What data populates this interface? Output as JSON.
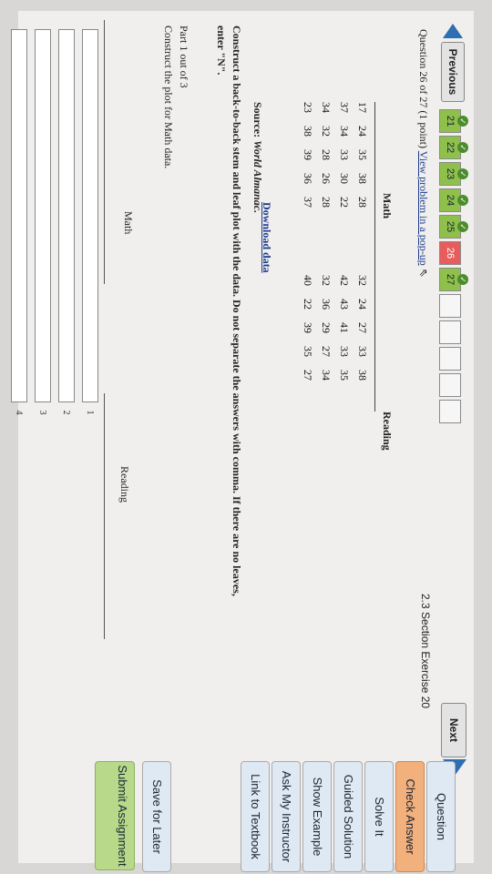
{
  "nav": {
    "previous_label": "Previous",
    "next_label": "Next",
    "question_numbers": [
      "21",
      "22",
      "23",
      "24",
      "25",
      "26",
      "27"
    ],
    "completed": [
      "21",
      "22",
      "23",
      "24",
      "25",
      "27"
    ],
    "current": "26"
  },
  "question": {
    "header": "Question 26 of 27 (1 point)",
    "popup_link": "View problem in a pop-up",
    "section": "2.3 Section Exercise 20"
  },
  "tables": {
    "math_title": "Math",
    "reading_title": "Reading",
    "math_rows": [
      [
        "17",
        "24",
        "35",
        "38",
        "28"
      ],
      [
        "37",
        "34",
        "33",
        "30",
        "22"
      ],
      [
        "34",
        "32",
        "28",
        "26",
        "28"
      ],
      [
        "23",
        "38",
        "39",
        "36",
        "37"
      ]
    ],
    "reading_rows": [
      [
        "32",
        "24",
        "27",
        "33",
        "38"
      ],
      [
        "42",
        "43",
        "41",
        "33",
        "35"
      ],
      [
        "32",
        "36",
        "29",
        "27",
        "34"
      ],
      [
        "40",
        "22",
        "39",
        "35",
        "27"
      ]
    ]
  },
  "source_label": "Source:",
  "source_name": "World Almanac.",
  "download_label": "Download data",
  "instructions": "Construct a back-to-back stem and leaf plot with the data. Do not separate the answers with comma. If there are no leaves, enter \"N\".",
  "part": {
    "title": "Part 1 out of 3",
    "text": "Construct the plot for Math data."
  },
  "plot": {
    "math_label": "Math",
    "reading_label": "Reading",
    "stems": [
      "1",
      "2",
      "3",
      "4"
    ]
  },
  "side": {
    "question_tab": "Question",
    "check_answer": "Check Answer",
    "solve_it": "Solve It",
    "guided_solution": "Guided Solution",
    "show_example": "Show Example",
    "ask_instructor": "Ask My Instructor",
    "link_textbook": "Link to Textbook",
    "save_later": "Save for Later",
    "submit": "Submit Assignment"
  },
  "colors": {
    "accent_blue": "#2d6fb0",
    "check_answer_bg": "#f2b07c",
    "side_btn_bg": "#dfe9f3",
    "submit_bg": "#b8d98a",
    "completed_green": "#8fc04b",
    "current_red": "#e85c5c"
  }
}
